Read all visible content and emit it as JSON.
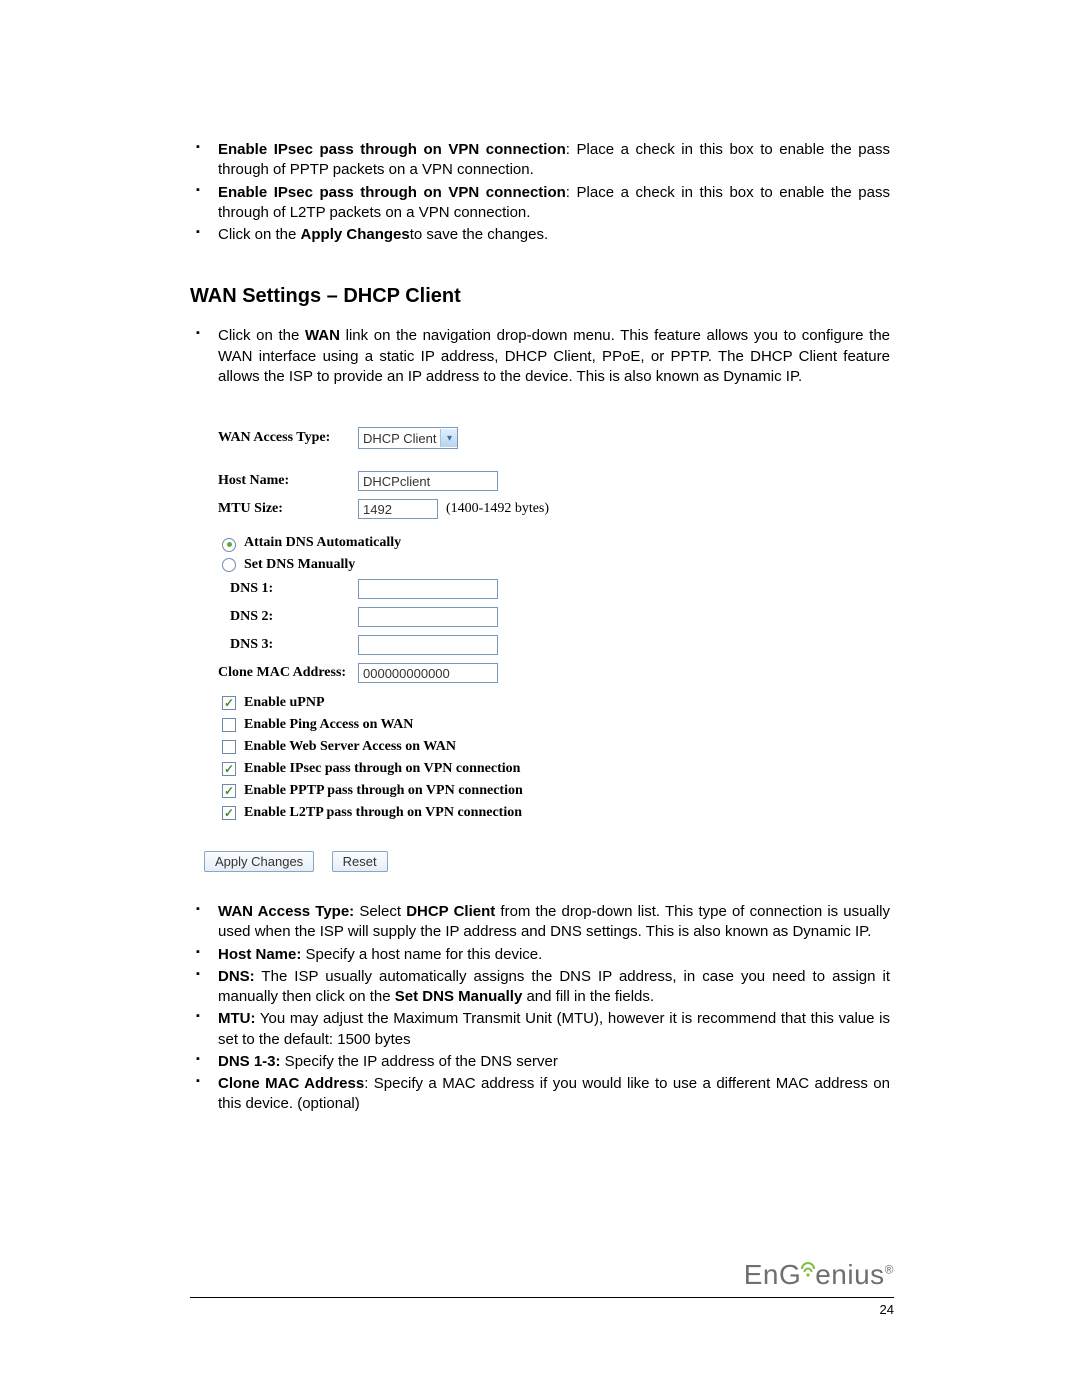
{
  "bullets_top": [
    {
      "bold": "Enable IPsec pass through on VPN connection",
      "rest": ": Place a check in this box to enable the pass through of PPTP packets on a VPN connection."
    },
    {
      "bold": "Enable IPsec pass through on VPN connection",
      "rest": ": Place a check in this box to enable the pass through of L2TP packets on a VPN connection."
    },
    {
      "pre": "Click on the ",
      "bold": "Apply Changes",
      "rest": "to save the changes."
    }
  ],
  "heading": "WAN Settings – DHCP Client",
  "bullets_mid": [
    {
      "pre": "Click on the ",
      "bold": "WAN",
      "rest": " link on the navigation drop-down menu. This feature allows you to configure the WAN interface using a static IP address, DHCP Client, PPoE, or PPTP. The DHCP Client feature allows the ISP to provide an IP address to the device. This is also known as Dynamic IP."
    }
  ],
  "form": {
    "wan_access_label": "WAN Access Type:",
    "wan_access_value": "DHCP Client",
    "host_name_label": "Host Name:",
    "host_name_value": "DHCPclient",
    "mtu_label": "MTU Size:",
    "mtu_value": "1492",
    "mtu_hint": "(1400-1492 bytes)",
    "radio_auto": "Attain DNS Automatically",
    "radio_manual": "Set DNS Manually",
    "dns1_label": "DNS 1:",
    "dns2_label": "DNS 2:",
    "dns3_label": "DNS 3:",
    "dns1_value": "",
    "dns2_value": "",
    "dns3_value": "",
    "clone_mac_label": "Clone MAC Address:",
    "clone_mac_value": "000000000000",
    "checks": [
      {
        "label": "Enable uPNP",
        "checked": true
      },
      {
        "label": "Enable Ping Access on WAN",
        "checked": false
      },
      {
        "label": "Enable Web Server Access on WAN",
        "checked": false
      },
      {
        "label": "Enable IPsec pass through on VPN connection",
        "checked": true
      },
      {
        "label": "Enable PPTP pass through on VPN connection",
        "checked": true
      },
      {
        "label": "Enable L2TP pass through on VPN connection",
        "checked": true
      }
    ],
    "btn_apply": "Apply Changes",
    "btn_reset": "Reset"
  },
  "bullets_bottom": [
    {
      "bold": "WAN Access Type:",
      "mid": " Select ",
      "bold2": "DHCP Client",
      "rest": " from the drop-down list. This type of connection is usually used when the ISP will supply the IP address and DNS settings. This is also known as Dynamic IP."
    },
    {
      "bold": "Host Name:",
      "rest": " Specify a host name for this device."
    },
    {
      "bold": "DNS:",
      "mid": " The ISP usually automatically assigns the DNS IP address, in case you need to assign it manually then click on the ",
      "bold2": "Set DNS Manually",
      "rest": " and fill in the fields."
    },
    {
      "bold": "MTU:",
      "rest": " You may adjust the Maximum Transmit Unit (MTU), however it is recommend that this value is set to the default: 1500 bytes"
    },
    {
      "bold": "DNS 1-3:",
      "rest": " Specify the IP address of the DNS server"
    },
    {
      "bold": "Clone MAC Address",
      "rest": ": Specify a MAC address if you would like to use a different MAC address on this device. (optional)"
    }
  ],
  "footer": {
    "brand_left": "En",
    "brand_right": "enius",
    "reg": "®",
    "page_number": "24"
  }
}
